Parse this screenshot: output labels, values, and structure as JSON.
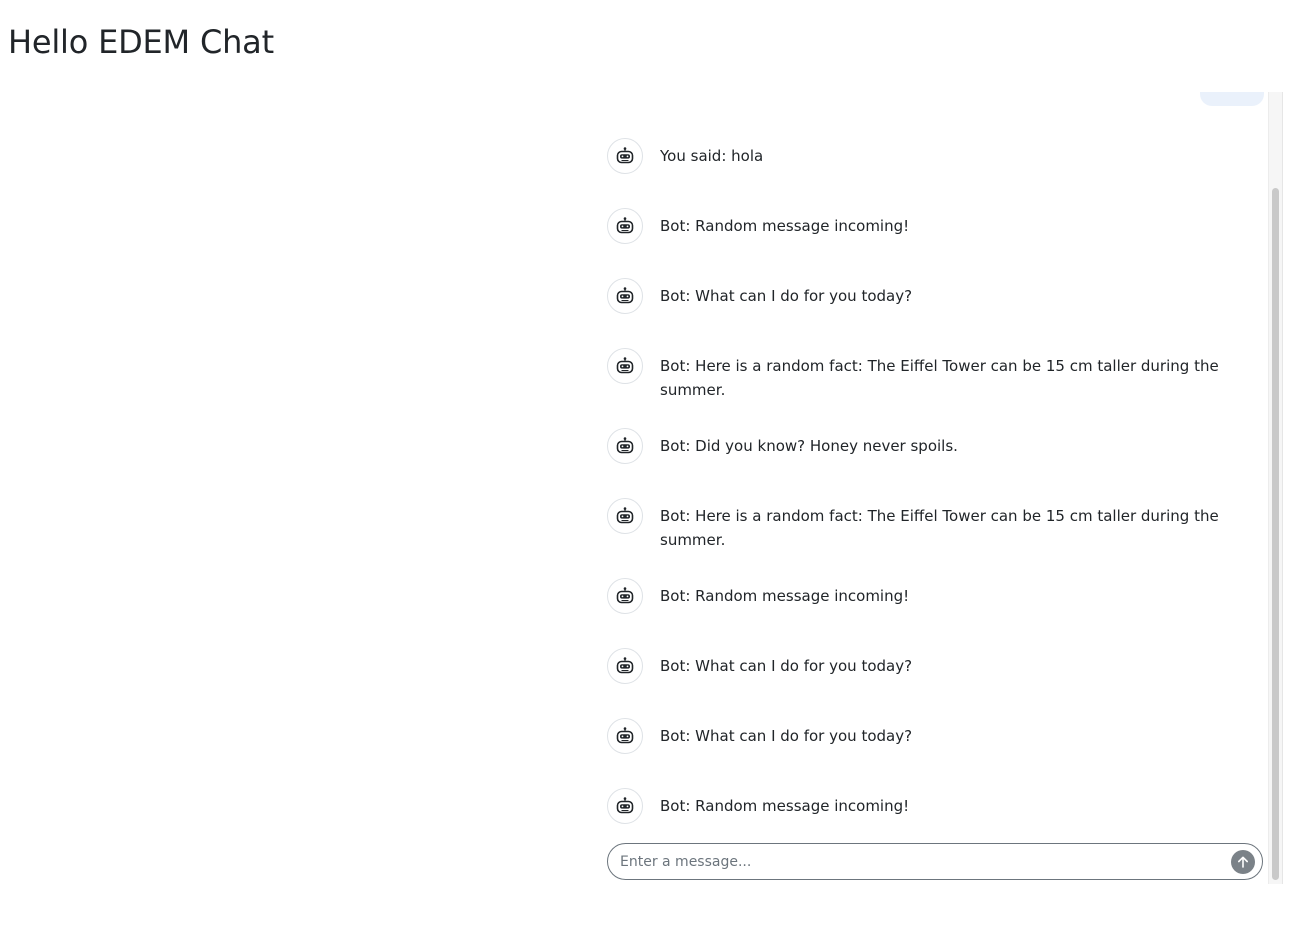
{
  "page": {
    "title": "Hello EDEM Chat"
  },
  "chat": {
    "messages": [
      {
        "text": "You said: hola",
        "icon": "robot-icon"
      },
      {
        "text": "Bot: Random message incoming!",
        "icon": "robot-icon"
      },
      {
        "text": "Bot: What can I do for you today?",
        "icon": "robot-icon"
      },
      {
        "text": "Bot: Here is a random fact: The Eiffel Tower can be 15 cm taller during the summer.",
        "icon": "robot-icon"
      },
      {
        "text": "Bot: Did you know? Honey never spoils.",
        "icon": "robot-icon"
      },
      {
        "text": "Bot: Here is a random fact: The Eiffel Tower can be 15 cm taller during the summer.",
        "icon": "robot-icon"
      },
      {
        "text": "Bot: Random message incoming!",
        "icon": "robot-icon"
      },
      {
        "text": "Bot: What can I do for you today?",
        "icon": "robot-icon"
      },
      {
        "text": "Bot: What can I do for you today?",
        "icon": "robot-icon"
      },
      {
        "text": "Bot: Random message incoming!",
        "icon": "robot-icon"
      }
    ]
  },
  "composer": {
    "placeholder": "Enter a message...",
    "value": "",
    "send_icon": "arrow-up-icon"
  },
  "colors": {
    "send_button": "#7b8288",
    "user_bubble": "#eaf1fb",
    "text": "#212529"
  }
}
